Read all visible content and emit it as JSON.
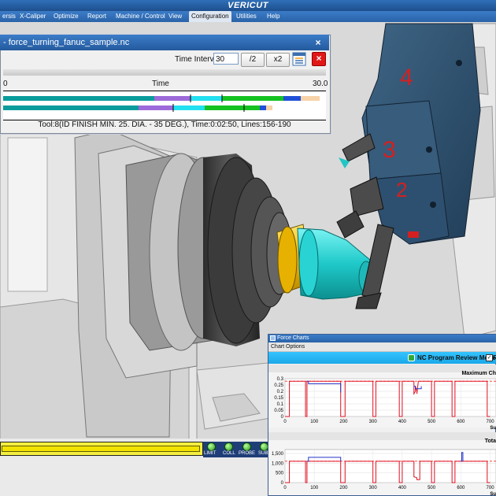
{
  "app": {
    "title": "VERICUT"
  },
  "menu": [
    {
      "label": "ersis"
    },
    {
      "label": "X-Caliper"
    },
    {
      "label": "Optimize"
    },
    {
      "label": "Report"
    },
    {
      "label": "Machine / Control"
    },
    {
      "label": "View"
    },
    {
      "label": "Configuration"
    },
    {
      "label": "Utilities"
    },
    {
      "label": "Help"
    }
  ],
  "time_dialog": {
    "title": "- force_turning_fanuc_sample.nc",
    "close_glyph": "×",
    "time_interval_label": "Time Interval",
    "time_interval_value": "30",
    "half_button": "/2",
    "double_button": "x2",
    "axis_start": "0",
    "axis_label": "Time",
    "axis_end": "30.0",
    "status": "Tool:8(ID FINISH MIN. 25. DIA. - 35 DEG.), Time:0:02:50, Lines:156-190",
    "colors": {
      "dark_teal": "#0a9c9c",
      "purple": "#9d6ad9",
      "cyan": "#22e0f0",
      "green": "#15c222",
      "blue": "#2050d8",
      "peach": "#f8d2a8"
    }
  },
  "scene": {
    "turret_labels": [
      "4",
      "3",
      "2"
    ]
  },
  "bottom": {
    "leds": [
      {
        "label": "LIMIT"
      },
      {
        "label": "COLL"
      },
      {
        "label": "PROBE"
      },
      {
        "label": "SUB"
      }
    ]
  },
  "force_charts": {
    "title": "Force Charts",
    "menu_label": "Chart Options",
    "mode_label": "NC Program Review Mode:",
    "mode_suffix": "R",
    "mode_checked": "✓",
    "colors": {
      "red": "#e01020",
      "blue": "#2232c8",
      "dash": "#ff2a2a"
    }
  },
  "chart_data": [
    {
      "type": "line",
      "title": "Maximum Ch",
      "xlabel": "Su",
      "x_ticks": [
        "0",
        "100",
        "200",
        "300",
        "400",
        "500",
        "600",
        "700"
      ],
      "y_ticks": [
        "0",
        "0.05",
        "0.1",
        "0.15",
        "0.2",
        "0.25",
        "0.3"
      ],
      "xlim": [
        0,
        720
      ],
      "ylim": [
        0,
        0.3
      ],
      "series": [
        {
          "x": [
            0,
            15,
            15,
            70,
            70,
            75,
            75,
            190,
            190,
            205,
            205,
            300,
            300,
            310,
            310,
            390,
            390,
            400,
            400,
            440,
            440,
            445,
            445,
            450,
            450,
            455,
            455,
            500,
            500,
            510,
            510,
            570,
            570,
            580,
            580,
            690,
            690,
            700
          ],
          "y": [
            0,
            0,
            0.28,
            0.28,
            0,
            0,
            0.28,
            0.28,
            0,
            0,
            0.28,
            0.28,
            0,
            0,
            0.28,
            0.28,
            0,
            0,
            0.28,
            0.28,
            0.18,
            0.2,
            0.24,
            0.2,
            0.18,
            0.28,
            0.28,
            0.28,
            0,
            0,
            0.28,
            0.28,
            0,
            0,
            0.28,
            0.28,
            0,
            0
          ]
        },
        {
          "x": [
            75,
            80,
            80,
            190,
            190
          ],
          "y": [
            0.28,
            0.28,
            0.26,
            0.26,
            0.19
          ]
        },
        {
          "x": [
            440,
            445,
            445,
            465,
            465
          ],
          "y": [
            0.24,
            0.24,
            0.22,
            0.22,
            0.24
          ]
        }
      ],
      "reference_lines": [
        0.28
      ]
    },
    {
      "type": "line",
      "title": "Tota",
      "xlabel": "Su",
      "x_ticks": [
        "0",
        "100",
        "200",
        "300",
        "400",
        "500",
        "600",
        "700"
      ],
      "y_ticks": [
        "0",
        "500",
        "1,000",
        "1,500"
      ],
      "xlim": [
        0,
        720
      ],
      "ylim": [
        0,
        1700
      ],
      "series": [
        {
          "x": [
            0,
            15,
            15,
            70,
            70,
            75,
            75,
            190,
            190,
            205,
            205,
            300,
            300,
            310,
            310,
            390,
            390,
            400,
            400,
            440,
            440,
            450,
            450,
            460,
            460,
            500,
            500,
            510,
            510,
            570,
            570,
            580,
            580,
            690,
            690,
            700
          ],
          "y": [
            0,
            0,
            1100,
            1100,
            0,
            0,
            1100,
            1100,
            0,
            0,
            1100,
            1100,
            0,
            0,
            1100,
            1100,
            0,
            0,
            1100,
            1100,
            300,
            250,
            150,
            150,
            1100,
            1100,
            0,
            0,
            1100,
            1100,
            0,
            0,
            1100,
            1100,
            0,
            0
          ]
        },
        {
          "x": [
            75,
            80,
            80,
            190,
            190
          ],
          "y": [
            1100,
            1100,
            1300,
            1300,
            1100
          ]
        },
        {
          "x": [
            600,
            603,
            603,
            607,
            607
          ],
          "y": [
            1100,
            1100,
            1550,
            1550,
            1100
          ]
        }
      ],
      "reference_lines": [
        1100
      ]
    }
  ]
}
